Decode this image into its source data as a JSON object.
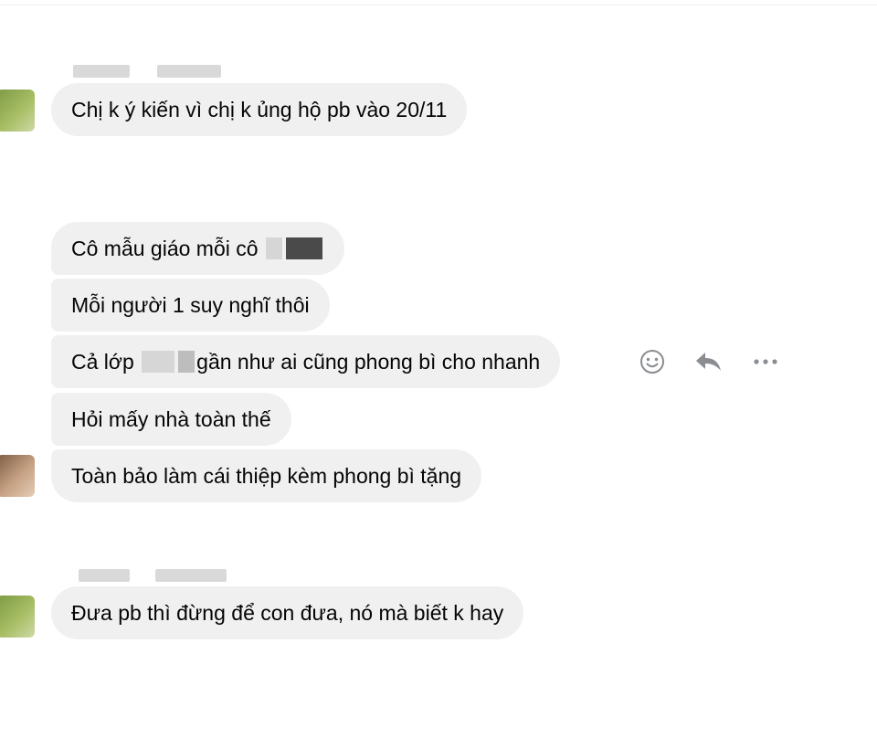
{
  "conversation": {
    "messages": [
      {
        "text": "Chị k ý kiến vì chị k ủng hộ pb vào 20/11"
      },
      {
        "text_before": "Cô mẫu giáo mỗi cô ",
        "text_after": ""
      },
      {
        "text": "Mỗi người 1 suy nghĩ thôi"
      },
      {
        "text_before": "Cả lớp ",
        "text_after": "gần như ai cũng phong bì cho nhanh"
      },
      {
        "text": "Hỏi mấy nhà toàn thế"
      },
      {
        "text": "Toàn bảo làm cái thiệp kèm phong bì tặng"
      },
      {
        "text": "Đưa pb thì đừng để con đưa, nó mà biết k hay"
      }
    ]
  },
  "message_actions": {
    "icons": [
      "emoji-reaction-icon",
      "reply-icon",
      "more-options-icon"
    ]
  },
  "colors": {
    "bubble_bg": "#f0f0f0",
    "text": "#050505",
    "icon": "#8a8d91"
  }
}
